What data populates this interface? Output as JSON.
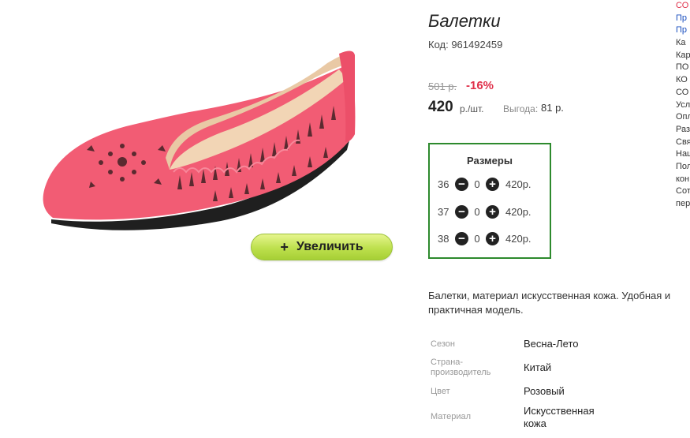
{
  "product": {
    "title": "Балетки",
    "sku": "Код: 961492459",
    "old_price": "501 р.",
    "discount": "-16%",
    "price": "420",
    "price_unit": "р./шт.",
    "savings_label": "Выгода:",
    "savings_value": "81 р.",
    "zoom_button": "Увеличить",
    "image_colors": {
      "shoe": "#f25c74",
      "insole": "#e9c9a5",
      "sole": "#222222"
    }
  },
  "sizes": {
    "title": "Размеры",
    "rows": [
      {
        "size": "36",
        "qty": "0",
        "price": "420р."
      },
      {
        "size": "37",
        "qty": "0",
        "price": "420р."
      },
      {
        "size": "38",
        "qty": "0",
        "price": "420р."
      }
    ]
  },
  "description": "Балетки, материал искусственная кожа. Удобная и практичная модель.",
  "attributes": [
    {
      "name": "Сезон",
      "value": "Весна-Лето"
    },
    {
      "name": "Страна-производитель",
      "value": "Китай"
    },
    {
      "name": "Цвет",
      "value": "Розовый"
    },
    {
      "name": "Материал",
      "value": "Искусственная кожа"
    }
  ],
  "sidebar": {
    "links": [
      "СО",
      "Пр",
      "Пр",
      "Ка",
      "Кар",
      "ПО",
      "КО",
      "СО",
      "Усл",
      "Опл",
      "Раз",
      "Свя",
      "Наш",
      "Пол",
      "кон",
      "Сот",
      "пер"
    ]
  },
  "colors": {
    "accent_red": "#e0304a",
    "sizes_border": "#2d8a2d",
    "zoom_button": "#bde04d"
  }
}
